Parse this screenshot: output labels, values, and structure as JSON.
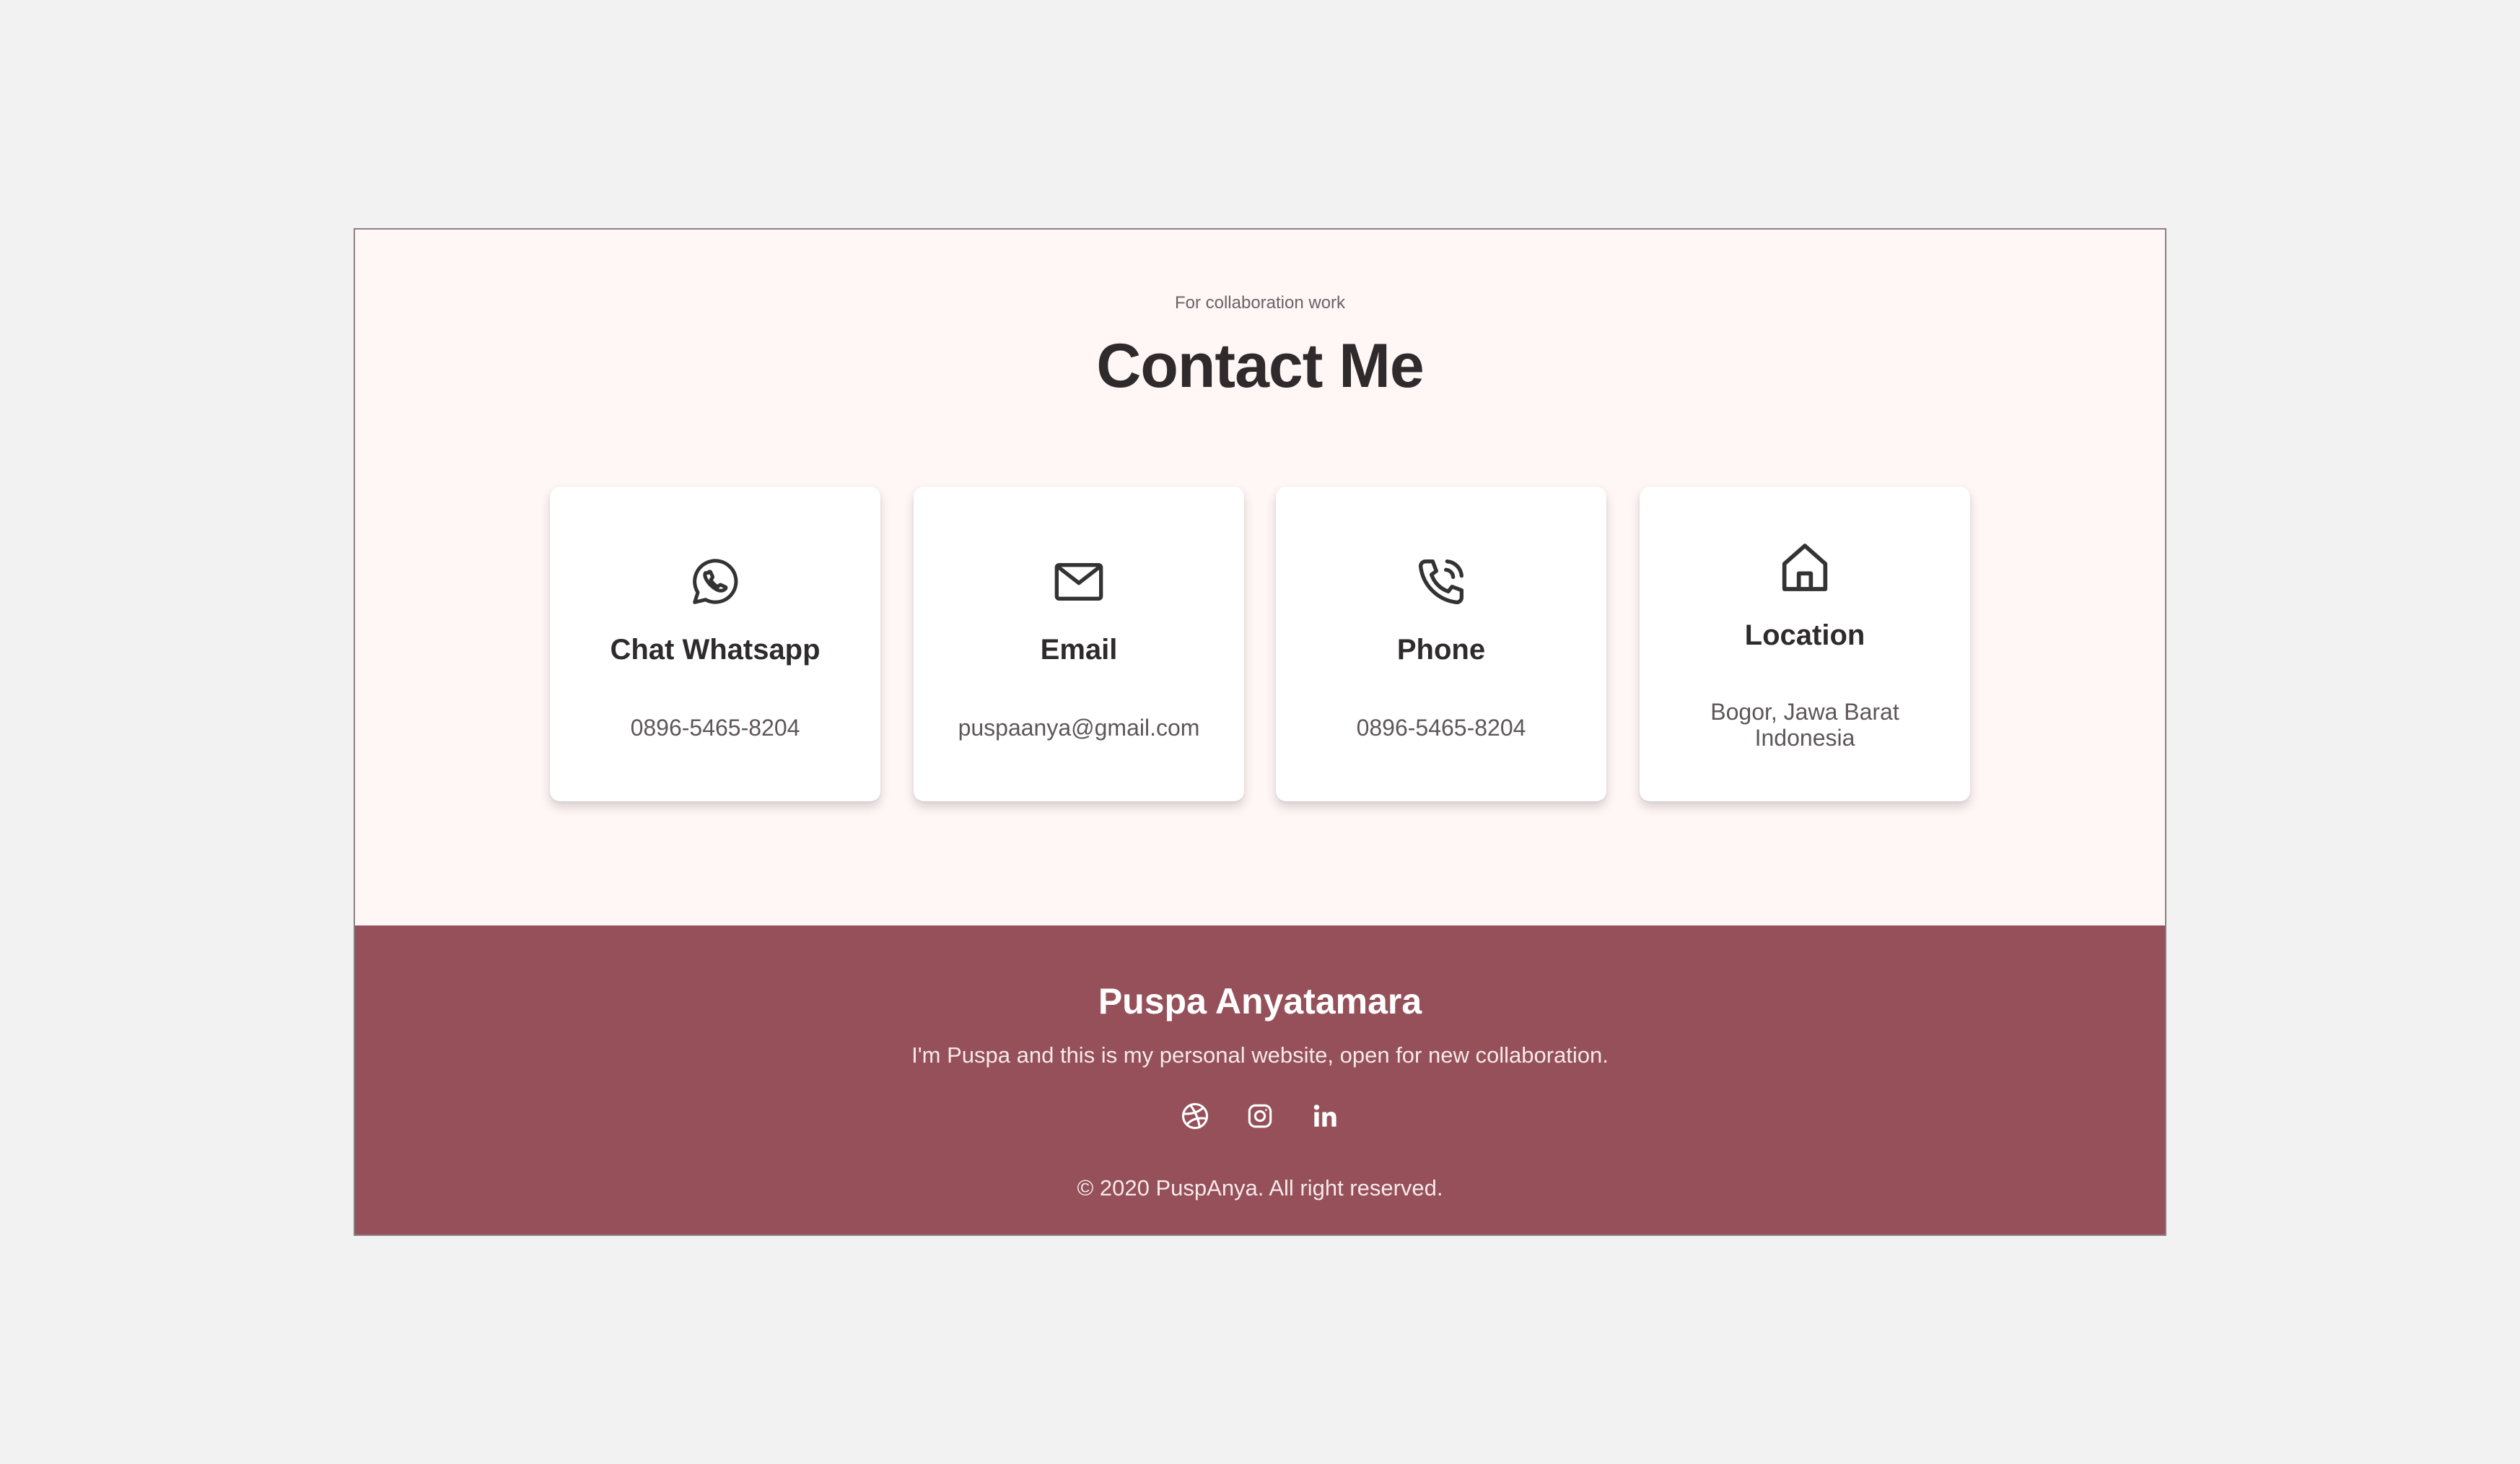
{
  "contact": {
    "eyebrow": "For collaboration work",
    "title": "Contact Me",
    "cards": [
      {
        "icon": "whatsapp-icon",
        "title": "Chat Whatsapp",
        "value": "0896-5465-8204"
      },
      {
        "icon": "mail-icon",
        "title": "Email",
        "value": "puspaanya@gmail.com"
      },
      {
        "icon": "phone-icon",
        "title": "Phone",
        "value": "0896-5465-8204"
      },
      {
        "icon": "home-icon",
        "title": "Location",
        "value": "Bogor, Jawa Barat Indonesia"
      }
    ]
  },
  "footer": {
    "name": "Puspa Anyatamara",
    "tagline": "I'm Puspa and this is my personal website, open for new collaboration.",
    "social": [
      {
        "icon": "dribbble-icon"
      },
      {
        "icon": "instagram-icon"
      },
      {
        "icon": "linkedin-icon"
      }
    ],
    "copyright": "© 2020 PuspAnya. All right reserved."
  },
  "colors": {
    "page_background": "#f2f2f2",
    "section_background": "#fff6f6",
    "footer_background": "#955059",
    "heading_text": "#2f2a2b",
    "body_text": "#5e5659"
  }
}
